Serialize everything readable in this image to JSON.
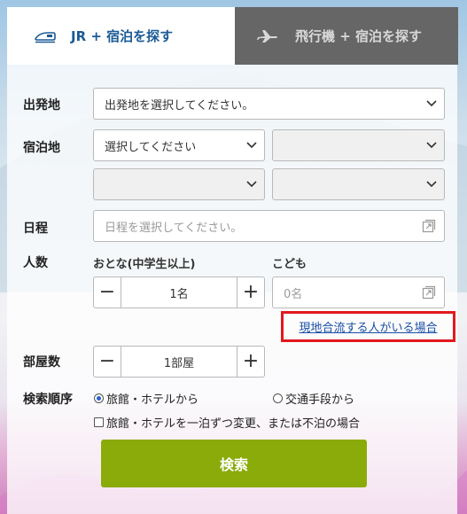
{
  "tabs": {
    "jr": {
      "label": "JR + 宿泊を探す",
      "icon": "train-icon"
    },
    "air": {
      "label": "飛行機 + 宿泊を探す",
      "icon": "airplane-icon"
    }
  },
  "form": {
    "departure": {
      "label": "出発地",
      "value": "出発地を選択してください。"
    },
    "lodging": {
      "label": "宿泊地",
      "select1": "選択してください",
      "select2": "",
      "select3": "",
      "select4": ""
    },
    "date": {
      "label": "日程",
      "placeholder": "日程を選択してください。"
    },
    "people": {
      "label": "人数",
      "adults_label": "おとな(中学生以上)",
      "adults_value": "1名",
      "children_label": "こども",
      "children_value": "0名",
      "minus": "−",
      "plus": "+"
    },
    "join_link": "現地合流する人がいる場合",
    "rooms": {
      "label": "部屋数",
      "value": "1部屋"
    },
    "sort": {
      "label": "検索順序",
      "option1": "旅館・ホテルから",
      "option2": "交通手段から",
      "checkbox": "旅館・ホテルを一泊ずつ変更、または不泊の場合"
    },
    "search_button": "検索"
  },
  "colors": {
    "tab_active_text": "#1b5a96",
    "tab_inactive_bg": "#666666",
    "search_button": "#8aab0a",
    "link": "#1a4fa5",
    "highlight_border": "#e0191f"
  }
}
